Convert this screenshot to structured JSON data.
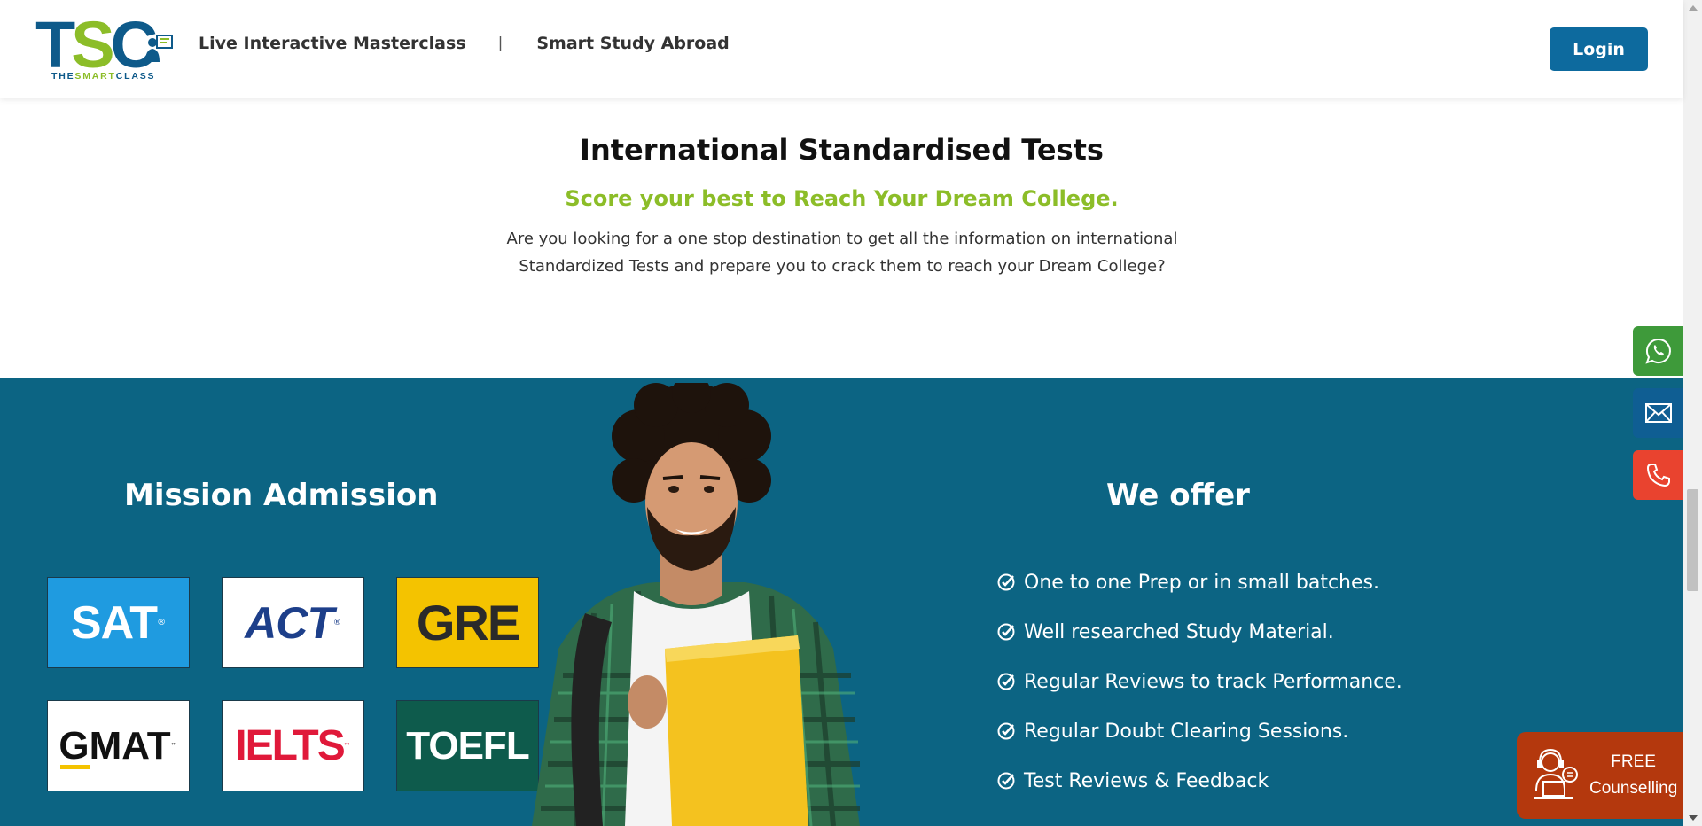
{
  "header": {
    "logo": {
      "letters": {
        "t": "T",
        "s": "S",
        "c": "C"
      },
      "sub_brand": "THE",
      "sub_accent": "SMART",
      "sub_tail": "CLASS"
    },
    "nav": [
      {
        "label": "Live Interactive Masterclass"
      },
      {
        "separator": "|"
      },
      {
        "label": "Smart Study Abroad"
      }
    ],
    "login_label": "Login"
  },
  "intro": {
    "title": "International Standardised Tests",
    "subtitle": "Score your best to Reach Your Dream College.",
    "description": "Are you looking for a one stop destination to get all the information on international Standardized Tests and prepare you to crack them to reach your Dream College?"
  },
  "mission": {
    "title": "Mission Admission",
    "tests": [
      {
        "label": "SAT",
        "mark": "®"
      },
      {
        "label": "ACT",
        "mark": "®"
      },
      {
        "label": "GRE"
      },
      {
        "label": "GMAT",
        "mark": "™"
      },
      {
        "label": "IELTS",
        "mark": "™"
      },
      {
        "label": "TOEFL"
      }
    ]
  },
  "offer": {
    "title": "We offer",
    "items": [
      "One to one Prep or in small batches.",
      "Well researched Study Material.",
      "Regular Reviews to track Performance.",
      "Regular Doubt Clearing Sessions.",
      "Test Reviews & Feedback"
    ]
  },
  "side_buttons": {
    "whatsapp_icon": "whatsapp-icon",
    "mail_icon": "mail-icon",
    "phone_icon": "phone-icon"
  },
  "free_counselling": {
    "line1": "FREE",
    "line2": "Counselling"
  },
  "colors": {
    "brand_blue": "#0d6a9e",
    "brand_green": "#8cbd28",
    "band": "#0c6483",
    "whatsapp": "#3e9a3a",
    "mail": "#0f5e93",
    "phone": "#e9432f",
    "counselling": "#b4380d"
  }
}
